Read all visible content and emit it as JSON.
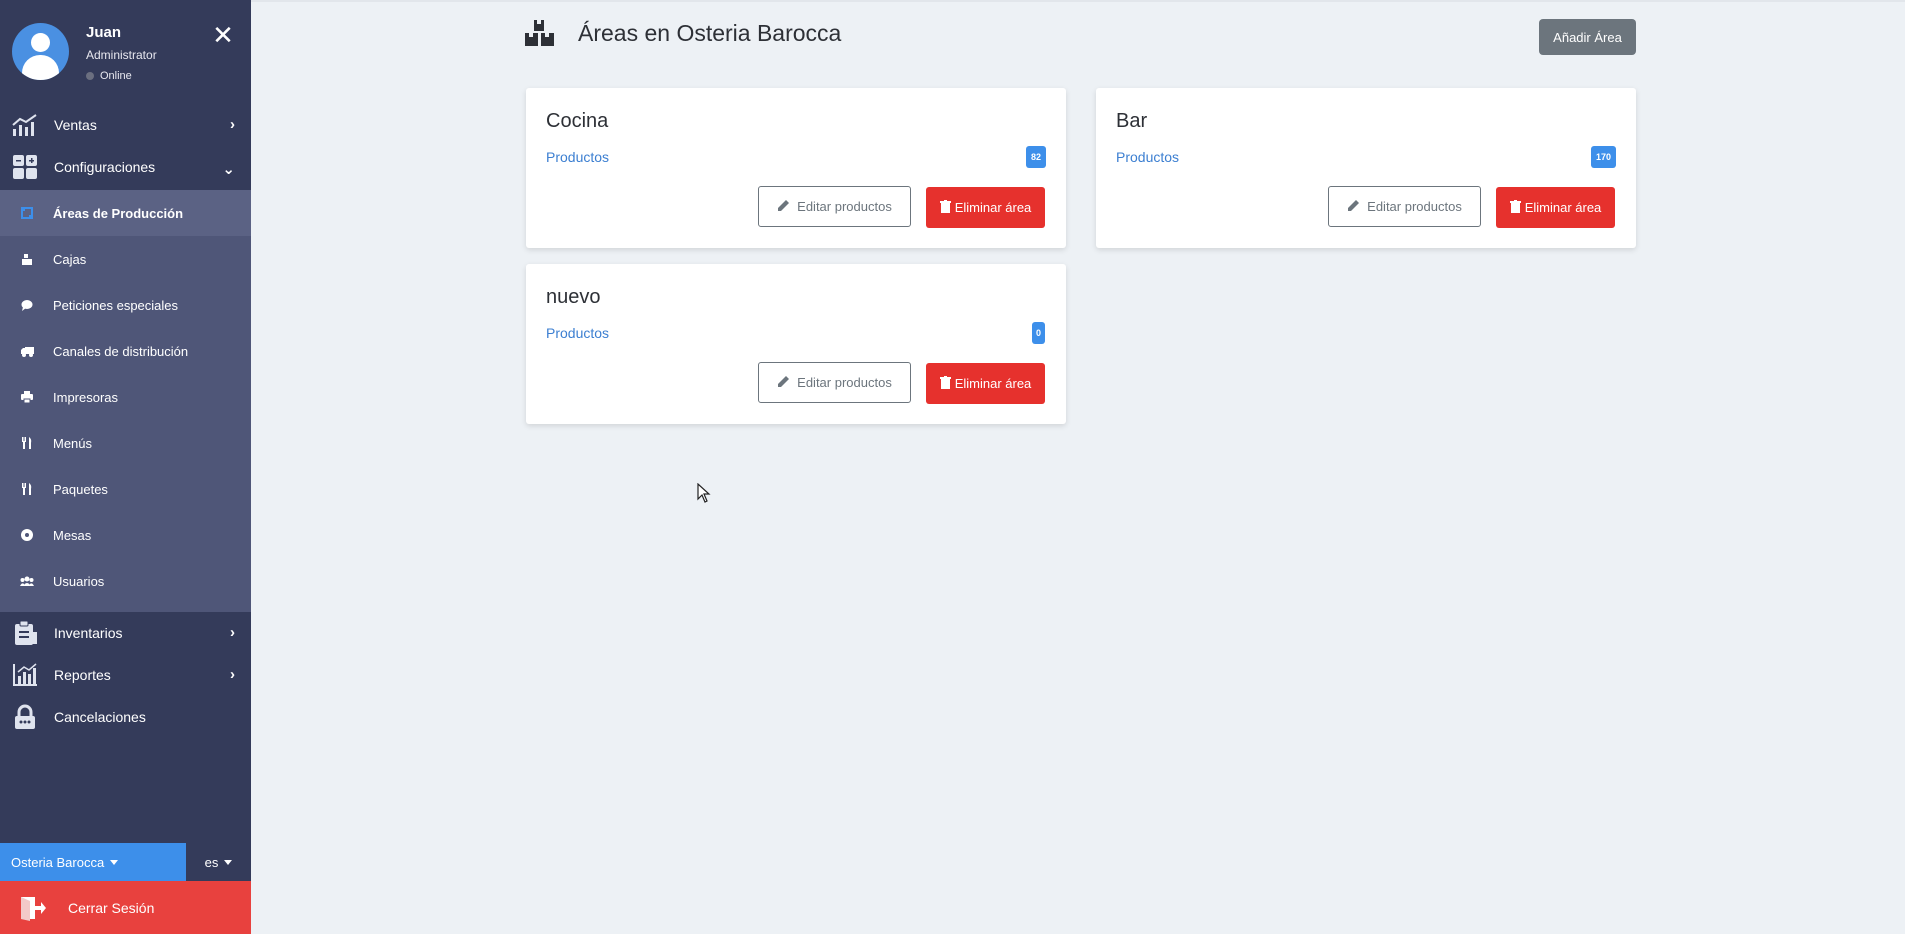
{
  "user": {
    "name": "Juan",
    "role": "Administrator",
    "status": "Online"
  },
  "sidebar": {
    "menu": [
      {
        "label": "Ventas",
        "icon": "chart-line-icon"
      },
      {
        "label": "Configuraciones",
        "icon": "calculator-icon"
      },
      {
        "label": "Inventarios",
        "icon": "clipboard-icon"
      },
      {
        "label": "Reportes",
        "icon": "bar-chart-icon"
      },
      {
        "label": "Cancelaciones",
        "icon": "lock-icon"
      }
    ],
    "submenu": [
      {
        "label": "Áreas de Producción",
        "icon": "boxes-icon",
        "active": true
      },
      {
        "label": "Cajas",
        "icon": "cash-register-icon"
      },
      {
        "label": "Peticiones especiales",
        "icon": "comment-icon"
      },
      {
        "label": "Canales de distribución",
        "icon": "truck-icon"
      },
      {
        "label": "Impresoras",
        "icon": "printer-icon"
      },
      {
        "label": "Menús",
        "icon": "utensils-icon"
      },
      {
        "label": "Paquetes",
        "icon": "utensils-icon"
      },
      {
        "label": "Mesas",
        "icon": "circle-dot-icon"
      },
      {
        "label": "Usuarios",
        "icon": "users-icon"
      }
    ],
    "branch": "Osteria Barocca",
    "language": "es",
    "logout": "Cerrar Sesión"
  },
  "main": {
    "title": "Áreas en Osteria Barocca",
    "add_button": "Añadir Área",
    "edit_label": "Editar productos",
    "delete_label": "Eliminar área",
    "areas": [
      {
        "name": "Cocina",
        "link": "Productos",
        "count": "82"
      },
      {
        "name": "Bar",
        "link": "Productos",
        "count": "170"
      },
      {
        "name": "nuevo",
        "link": "Productos",
        "count": "0"
      }
    ]
  },
  "colors": {
    "sidebar": "#343b5a",
    "submenu": "#4f5678",
    "accent": "#3d8fea",
    "danger": "#e6312d",
    "logout": "#e8413e"
  }
}
